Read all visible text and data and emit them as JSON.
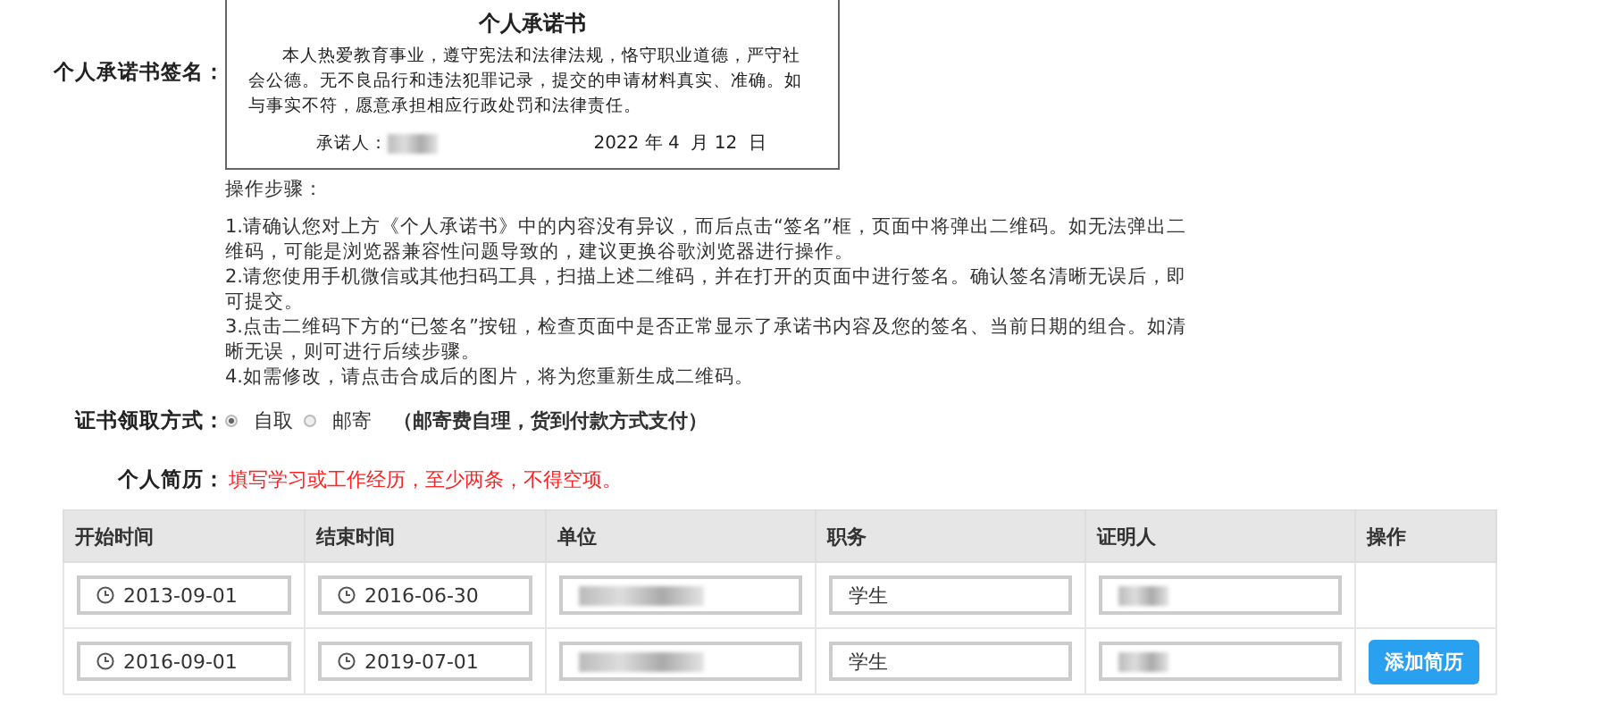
{
  "signature": {
    "label": "个人承诺书签名：",
    "document": {
      "title": "个人承诺书",
      "body": "本人热爱教育事业，遵守宪法和法律法规，恪守职业道德，严守社会公德。无不良品行和违法犯罪记录，提交的申请材料真实、准确。如与事实不符，愿意承担相应行政处罚和法律责任。",
      "signer_label": "承诺人：",
      "date": "2022 年 4  月 12  日"
    }
  },
  "steps": {
    "heading": "操作步骤：",
    "items": [
      "1.请确认您对上方《个人承诺书》中的内容没有异议，而后点击“签名”框，页面中将弹出二维码。如无法弹出二维码，可能是浏览器兼容性问题导致的，建议更换谷歌浏览器进行操作。",
      "2.请您使用手机微信或其他扫码工具，扫描上述二维码，并在打开的页面中进行签名。确认签名清晰无误后，即可提交。",
      "3.点击二维码下方的“已签名”按钮，检查页面中是否正常显示了承诺书内容及您的签名、当前日期的组合。如清晰无误，则可进行后续步骤。",
      "4.如需修改，请点击合成后的图片，将为您重新生成二维码。"
    ]
  },
  "delivery": {
    "label": "证书领取方式：",
    "options": [
      {
        "label": "自取",
        "selected": true
      },
      {
        "label": "邮寄",
        "selected": false
      }
    ],
    "note": "（邮寄费自理，货到付款方式支付）"
  },
  "resume": {
    "label": "个人简历：",
    "hint": "填写学习或工作经历，至少两条，不得空项。",
    "columns": [
      "开始时间",
      "结束时间",
      "单位",
      "职务",
      "证明人",
      "操作"
    ],
    "rows": [
      {
        "start": "2013-09-01",
        "end": "2016-06-30",
        "position": "学生"
      },
      {
        "start": "2016-09-01",
        "end": "2019-07-01",
        "position": "学生",
        "action": "添加简历"
      }
    ]
  }
}
